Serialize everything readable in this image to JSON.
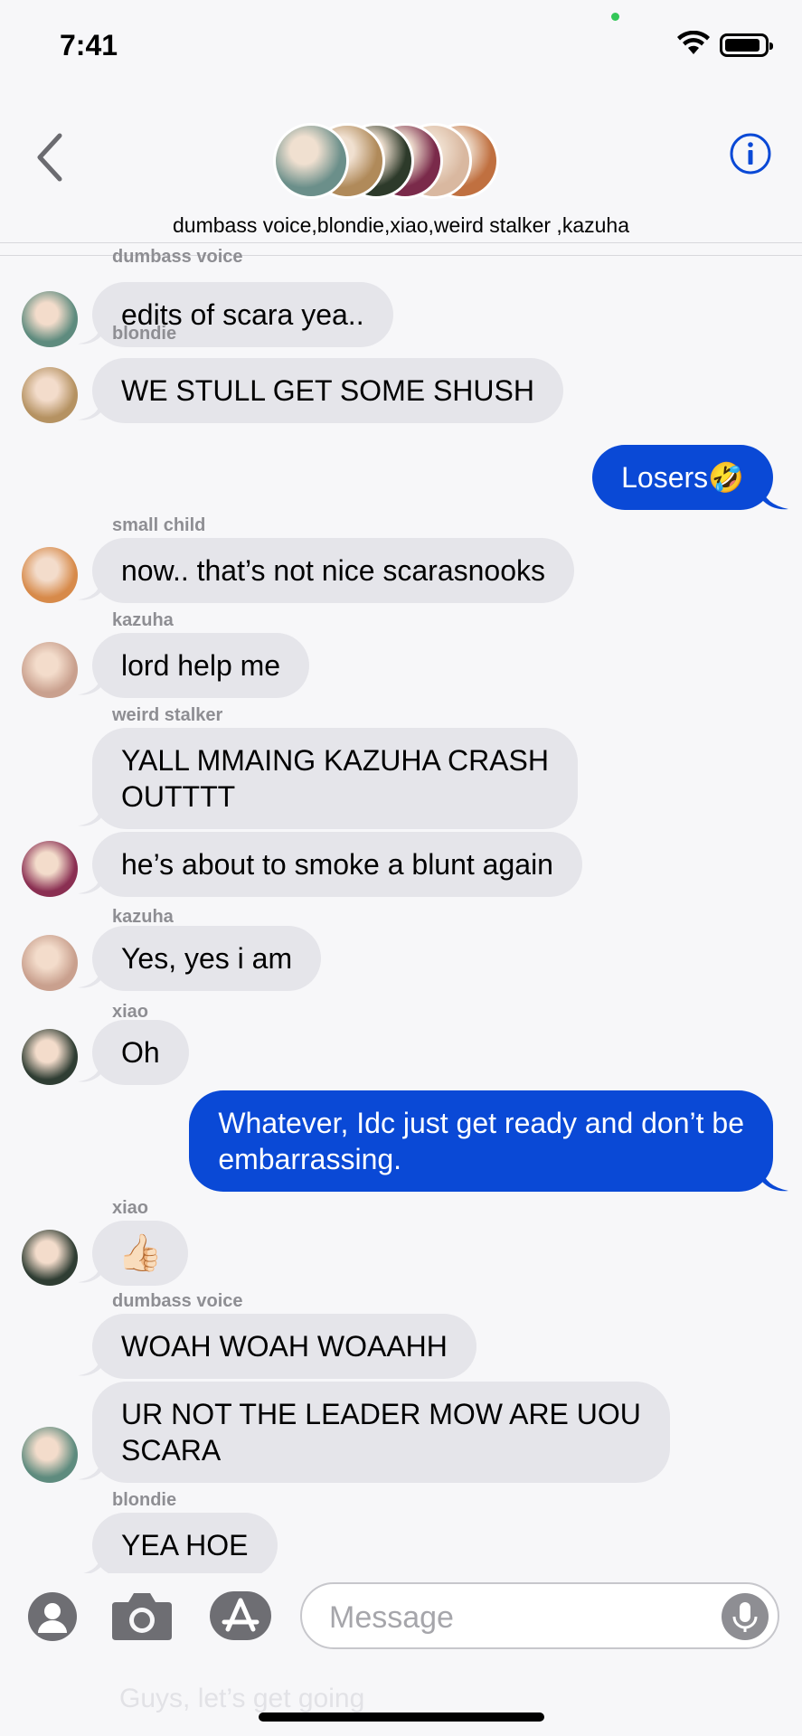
{
  "status": {
    "time": "7:41"
  },
  "header": {
    "group_name": "dumbass voice,blondie,xiao,weird stalker ,kazuha",
    "stack_colors": [
      "#6b8f8a",
      "#b08a5a",
      "#2d3a2a",
      "#7a2a4a",
      "#d9b8a0",
      "#c07040"
    ]
  },
  "messages": [
    {
      "sender": "dumbass voice",
      "text": "edits of scara yea..",
      "side": "in",
      "avatar_color": "#5e8b7e"
    },
    {
      "sender": "blondie",
      "text": "WE STULL GET SOME SHUSH",
      "side": "in",
      "avatar_color": "#b59262"
    },
    {
      "text": "Losers🤣",
      "side": "out"
    },
    {
      "sender": "small child",
      "text": "now.. that’s not nice scarasnooks",
      "side": "in",
      "avatar_color": "#d78a4a"
    },
    {
      "sender": "kazuha",
      "text": "lord help me",
      "side": "in",
      "avatar_color": "#c9a08e"
    },
    {
      "sender": "weird stalker",
      "text": "YALL MMAING KAZUHA CRASH\nOUTTTT",
      "side": "in"
    },
    {
      "text": "he’s about to smoke a blunt again",
      "side": "in",
      "avatar_color": "#8a2f52"
    },
    {
      "sender": "kazuha",
      "text": "Yes, yes i am",
      "side": "in",
      "avatar_color": "#c9a08e"
    },
    {
      "sender": "xiao",
      "text": "Oh",
      "side": "in",
      "avatar_color": "#2f3d33"
    },
    {
      "text": "Whatever, Idc just get ready and don’t be\nembarrassing.",
      "side": "out"
    },
    {
      "sender": "xiao",
      "text": "👍🏻",
      "side": "in",
      "avatar_color": "#2f3d33"
    },
    {
      "sender": "dumbass voice",
      "text": "WOAH WOAH WOAAHH",
      "side": "in"
    },
    {
      "text": "UR NOT THE LEADER MOW ARE UOU\nSCARA",
      "side": "in",
      "avatar_color": "#5e8b7e"
    },
    {
      "sender": "blondie",
      "text": "YEA HOE",
      "side": "in"
    }
  ],
  "input": {
    "placeholder": "Message",
    "ghost_text": "Guys, let’s get going"
  },
  "colors": {
    "outgoing": "#0a49d6",
    "incoming": "#e5e5ea",
    "accent": "#0a49d6"
  },
  "icons": [
    "back-chevron-icon",
    "info-icon",
    "contact-icon",
    "camera-icon",
    "app-store-icon",
    "microphone-icon"
  ]
}
